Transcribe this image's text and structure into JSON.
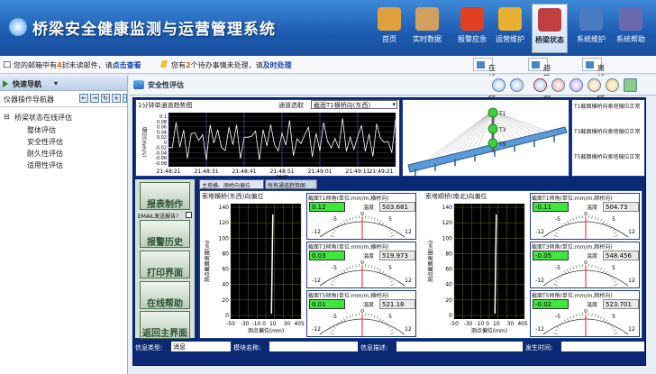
{
  "app": {
    "title": "桥梁安全健康监测与运营管理系统"
  },
  "nav": [
    {
      "label": "首页",
      "icon": "home-icon",
      "color": "#e0a040"
    },
    {
      "label": "实时数据",
      "icon": "data-icon",
      "color": "#d0a060"
    },
    {
      "label": "报警应急",
      "icon": "alarm-icon",
      "color": "#e04020"
    },
    {
      "label": "运营维护",
      "icon": "shield-icon",
      "color": "#e8b030"
    },
    {
      "label": "桥梁状态",
      "icon": "bridge-icon",
      "color": "#c04040",
      "active": true
    },
    {
      "label": "系统维护",
      "icon": "monitor-icon",
      "color": "#4a7ac0"
    },
    {
      "label": "系统帮助",
      "icon": "book-icon",
      "color": "#6a6ab0"
    }
  ],
  "notice": {
    "mail_pre": "您的邮箱中有",
    "mail_count": "4",
    "mail_mid": "封未读邮件，请",
    "mail_link": "点击查看",
    "todo_pre": "您有",
    "todo_count": "2",
    "todo_mid": "个待办事情未处理，请",
    "todo_link": "及时处理"
  },
  "top_tabs": [
    "在线评估",
    "趋势预测",
    "离线评估"
  ],
  "sidebar": {
    "quick_nav": "快速导航",
    "ops_nav": "仪器操作导航器",
    "tree_root": "桥梁状态在线评估",
    "items": [
      "整体评估",
      "安全性评估",
      "耐久性评估",
      "适用性评估"
    ]
  },
  "main": {
    "tab_title": "安全性评估"
  },
  "chart_panel": {
    "title": "1分钟单通道趋势图",
    "channel_label": "通道选取",
    "channel_value": "截面T1横桥向(东西)",
    "ylabel": "偏位(mm/s)",
    "xlabel": "时间",
    "yticks": [
      "0.1",
      "0.08",
      "0.06",
      "0.04",
      "0.02",
      "0",
      "-0.02",
      "-0.04",
      "-0.06",
      "-0.08"
    ],
    "xticks": [
      "21:48:21",
      "21:48:31",
      "21:48:41",
      "21:48:51",
      "21:49:01",
      "21:49:11",
      "21:49:21"
    ]
  },
  "bridge": {
    "points": [
      "T1",
      "T3",
      "T5"
    ],
    "legend": [
      "T1截面横桥向索塔偏位正常",
      "T3截面横桥向索塔偏位正常",
      "T5截面横桥向索塔偏位正常"
    ]
  },
  "lower_tabs": [
    "主塔横、顺桥向偏位",
    "所有通道趋势图"
  ],
  "side_buttons": [
    "报表制作",
    "报警历史",
    "打印界面",
    "在线帮助",
    "返回主界面"
  ],
  "email_check": "EMAIL发送报告?",
  "tower1": {
    "title": "索塔横桥(东西)向偏位",
    "ylabel": "测点截面高度(m)",
    "xlabel": "测点偏位(mm)",
    "yticks": [
      "140",
      "120",
      "100",
      "80",
      "60",
      "40",
      "20",
      "0"
    ],
    "xticks": [
      "-50",
      "-30",
      "-10 0",
      "10",
      "30",
      "4050"
    ]
  },
  "tower2": {
    "title": "索塔顺桥(南北)向偏位",
    "ylabel": "测点截面高度(m)",
    "xlabel": "测点偏位(mm)",
    "yticks": [
      "140",
      "120",
      "100",
      "80",
      "60",
      "40",
      "20",
      "0"
    ],
    "xticks": [
      "-50",
      "-30",
      "-10 0",
      "10",
      "30",
      "4050"
    ]
  },
  "gauges_left": [
    {
      "title": "截面T1倾角(单位:mm/m,横桥向)",
      "value": "0.12",
      "temp_label": "温度",
      "temp": "503.681"
    },
    {
      "title": "截面T3倾角(单位:mm/m,横桥向)",
      "value": "0.03",
      "temp_label": "温度",
      "temp": "519.973"
    },
    {
      "title": "截面T5倾角(单位:mm/m,横桥向)",
      "value": "0.01",
      "temp_label": "温度",
      "temp": "521.18"
    }
  ],
  "gauges_right": [
    {
      "title": "截面T1倾角(单位:mm/m,顺桥向)",
      "value": "-0.11",
      "temp_label": "温度",
      "temp": "504.73"
    },
    {
      "title": "截面T3倾角(单位:mm/m,顺桥向)",
      "value": "-0.05",
      "temp_label": "温度",
      "temp": "548.456"
    },
    {
      "title": "截面T5倾角(单位:mm/m,顺桥向)",
      "value": "-0.02",
      "temp_label": "温度",
      "temp": "523.701"
    }
  ],
  "gauge_scale": {
    "top": [
      "-5",
      "0",
      "5"
    ],
    "mid": [
      "-12",
      "12"
    ]
  },
  "status": {
    "type_label": "信息类型:",
    "type_value": "消息",
    "module_label": "模块名称:",
    "desc_label": "信息描述:",
    "time_label": "发生时间:"
  }
}
